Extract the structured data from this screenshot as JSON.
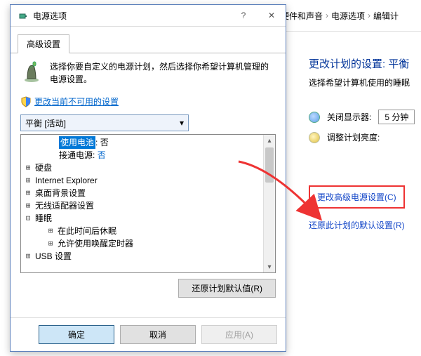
{
  "breadcrumb": {
    "item1": "硬件和声音",
    "item2": "电源选项",
    "item3": "编辑计"
  },
  "bg": {
    "heading": "更改计划的设置: 平衡",
    "sub": "选择希望计算机使用的睡眠",
    "row1_label": "关闭显示器:",
    "row1_value": "5 分钟",
    "row2_label": "调整计划亮度:",
    "link_box": "更改高级电源设置(C)",
    "link_restore": "还原此计划的默认设置(R)"
  },
  "dialog": {
    "title": "电源选项",
    "tab": "高级设置",
    "desc": "选择你要自定义的电源计划，然后选择你希望计算机管理的电源设置。",
    "shield_link": "更改当前不可用的设置",
    "plan": "平衡 [活动]",
    "tree": {
      "use_batt_label": "使用电池",
      "use_batt_value": "否",
      "ac_label": "接通电源:",
      "ac_value": "否",
      "disk": "硬盘",
      "ie": "Internet Explorer",
      "desktop": "桌面背景设置",
      "wifi": "无线适配器设置",
      "sleep": "睡眠",
      "sleep_after": "在此时间后休眠",
      "wake_timer": "允许使用唤醒定时器",
      "usb": "USB 设置"
    },
    "restore_btn": "还原计划默认值(R)",
    "ok": "确定",
    "cancel": "取消",
    "apply": "应用(A)"
  }
}
